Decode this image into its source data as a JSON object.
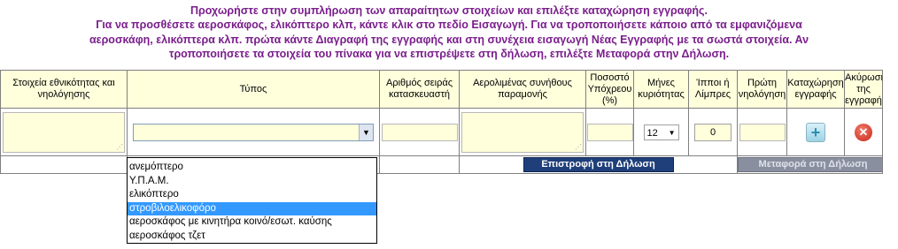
{
  "instructions": [
    "Προχωρήστε στην συμπλήρωση των απαραίτητων στοιχείων και επιλέξτε καταχώρηση εγγραφής.",
    "Για να προσθέσετε αεροσκάφος, ελικόπτερο κλπ, κάντε κλικ στο πεδίο Εισαγωγή. Για να τροποποιήσετε κάποιο από τα εμφανιζόμενα",
    "αεροσκάφη, ελικόπτερα κλπ. πρώτα κάντε Διαγραφή της εγγραφής και στη συνέχεια εισαγωγή Νέας Εγγραφής με τα σωστά στοιχεία. Αν",
    "τροποποιήσετε τα στοιχεία του πίνακα για να επιστρέψετε στη δήλωση, επιλέξτε Μεταφορά στην Δήλωση."
  ],
  "headers": {
    "id": "Στοιχεία εθνικότητας και νηολόγησης",
    "type": "Τύπος",
    "serial": "Αριθμός σειράς κατασκευαστή",
    "airport": "Αερολιμένας συνήθους παραμονής",
    "percent": "Ποσοστό Υπόχρεου (%)",
    "months": "Μήνες κυριότητας",
    "hp": "Ίπποι ή Λίμπρες",
    "firstreg": "Πρώτη νηολόγηση",
    "save": "Καταχώρηση εγγραφής",
    "cancel": "Ακύρωση της εγγραφή"
  },
  "row": {
    "months_value": "12",
    "hp_value": "0",
    "type_value": ""
  },
  "icons": {
    "add": "plus-icon",
    "cancel": "cancel-x-icon",
    "dropdown": "chevron-down-icon"
  },
  "buttons": {
    "back": "Επιστροφή στη Δήλωση",
    "transfer": "Μεταφορά στη Δήλωση"
  },
  "dropdown_options": [
    "ανεμόπτερο",
    "Υ.Π.Α.Μ.",
    "ελικόπτερο",
    "στροβιλοελικοφόρο",
    "αεροσκάφος με κινητήρα κοινό/εσωτ. καύσης",
    "αεροσκάφος τζετ"
  ],
  "dropdown_selected_index": 3,
  "colors": {
    "instruction_text": "#7a1e8c",
    "field_bg": "#ffffdc",
    "selected_option": "#3399ff",
    "button_dark": "#1f3f7a"
  }
}
